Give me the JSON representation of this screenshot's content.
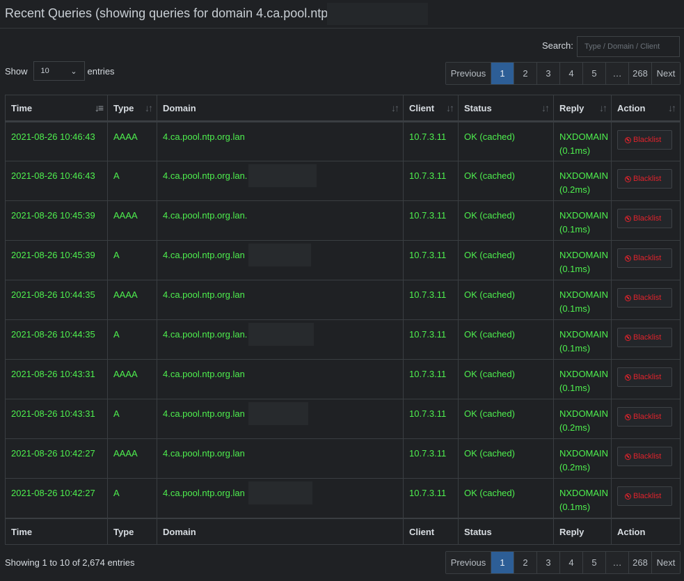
{
  "header": {
    "title": "Recent Queries (showing queries for domain 4.ca.pool.ntp.org"
  },
  "search": {
    "label": "Search:",
    "placeholder": "Type / Domain / Client"
  },
  "length": {
    "show_label": "Show",
    "value": "10",
    "entries_label": "entries"
  },
  "pagination": {
    "previous": "Previous",
    "pages": [
      "1",
      "2",
      "3",
      "4",
      "5",
      "…",
      "268"
    ],
    "active_page": "1",
    "next": "Next"
  },
  "columns": [
    "Time",
    "Type",
    "Domain",
    "Client",
    "Status",
    "Reply",
    "Action"
  ],
  "rows": [
    {
      "time": "2021-08-26 10:46:43",
      "type": "AAAA",
      "domain": "4.ca.pool.ntp.org.lan",
      "client": "10.7.3.11",
      "status": "OK (cached)",
      "reply": "NXDOMAIN",
      "reply_time": "(0.1ms)",
      "action": "Blacklist"
    },
    {
      "time": "2021-08-26 10:46:43",
      "type": "A",
      "domain": "4.ca.pool.ntp.org.lan.",
      "client": "10.7.3.11",
      "status": "OK (cached)",
      "reply": "NXDOMAIN",
      "reply_time": "(0.2ms)",
      "action": "Blacklist"
    },
    {
      "time": "2021-08-26 10:45:39",
      "type": "AAAA",
      "domain": "4.ca.pool.ntp.org.lan.",
      "client": "10.7.3.11",
      "status": "OK (cached)",
      "reply": "NXDOMAIN",
      "reply_time": "(0.1ms)",
      "action": "Blacklist"
    },
    {
      "time": "2021-08-26 10:45:39",
      "type": "A",
      "domain": "4.ca.pool.ntp.org.lan",
      "client": "10.7.3.11",
      "status": "OK (cached)",
      "reply": "NXDOMAIN",
      "reply_time": "(0.1ms)",
      "action": "Blacklist"
    },
    {
      "time": "2021-08-26 10:44:35",
      "type": "AAAA",
      "domain": "4.ca.pool.ntp.org.lan",
      "client": "10.7.3.11",
      "status": "OK (cached)",
      "reply": "NXDOMAIN",
      "reply_time": "(0.1ms)",
      "action": "Blacklist"
    },
    {
      "time": "2021-08-26 10:44:35",
      "type": "A",
      "domain": "4.ca.pool.ntp.org.lan.",
      "client": "10.7.3.11",
      "status": "OK (cached)",
      "reply": "NXDOMAIN",
      "reply_time": "(0.1ms)",
      "action": "Blacklist"
    },
    {
      "time": "2021-08-26 10:43:31",
      "type": "AAAA",
      "domain": "4.ca.pool.ntp.org.lan",
      "client": "10.7.3.11",
      "status": "OK (cached)",
      "reply": "NXDOMAIN",
      "reply_time": "(0.1ms)",
      "action": "Blacklist"
    },
    {
      "time": "2021-08-26 10:43:31",
      "type": "A",
      "domain": "4.ca.pool.ntp.org.lan",
      "client": "10.7.3.11",
      "status": "OK (cached)",
      "reply": "NXDOMAIN",
      "reply_time": "(0.2ms)",
      "action": "Blacklist"
    },
    {
      "time": "2021-08-26 10:42:27",
      "type": "AAAA",
      "domain": "4.ca.pool.ntp.org.lan",
      "client": "10.7.3.11",
      "status": "OK (cached)",
      "reply": "NXDOMAIN",
      "reply_time": "(0.2ms)",
      "action": "Blacklist"
    },
    {
      "time": "2021-08-26 10:42:27",
      "type": "A",
      "domain": "4.ca.pool.ntp.org.lan",
      "client": "10.7.3.11",
      "status": "OK (cached)",
      "reply": "NXDOMAIN",
      "reply_time": "(0.1ms)",
      "action": "Blacklist"
    }
  ],
  "info": "Showing 1 to 10 of 2,674 entries",
  "colors": {
    "background": "#1f2124",
    "text_green": "#4ef04e",
    "active_page": "#2d5e96",
    "blacklist_red": "#e0232c"
  },
  "icons": {
    "sort": "sort-arrows-icon",
    "sort_active": "sort-desc-icon",
    "select": "chevron-down-icon",
    "blacklist": "ban-icon"
  }
}
